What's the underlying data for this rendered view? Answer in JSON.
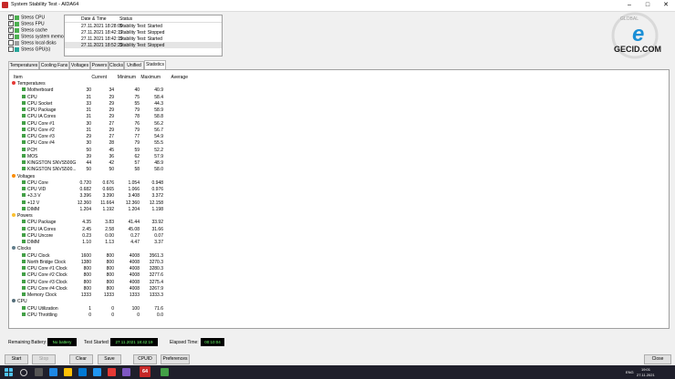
{
  "window": {
    "title": "System Stability Test - AIDA64"
  },
  "stress_options": [
    {
      "label": "Stress CPU",
      "checked": true
    },
    {
      "label": "Stress FPU",
      "checked": true
    },
    {
      "label": "Stress cache",
      "checked": true
    },
    {
      "label": "Stress system memory",
      "checked": true
    },
    {
      "label": "Stress local disks",
      "checked": false
    },
    {
      "label": "Stress GPU(s)",
      "checked": false
    }
  ],
  "log": {
    "headers": [
      "Date & Time",
      "Status"
    ],
    "rows": [
      [
        "27.11.2021 18:28:09",
        "Stability Test: Started"
      ],
      [
        "27.11.2021 18:42:17",
        "Stability Test: Stopped"
      ],
      [
        "27.11.2021 18:42:19",
        "Stability Test: Started"
      ],
      [
        "27.11.2021 18:52:23",
        "Stability Test: Stopped"
      ]
    ]
  },
  "logo": {
    "top": "GLOBAL",
    "main": "GECID.COM",
    "side": "e"
  },
  "tabs": [
    "Temperatures",
    "Cooling Fans",
    "Voltages",
    "Powers",
    "Clocks",
    "Unified",
    "Statistics"
  ],
  "active_tab": 6,
  "table": {
    "headers": [
      "Item",
      "Current",
      "Minimum",
      "Maximum",
      "Average"
    ],
    "rows": [
      {
        "t": "g",
        "label": "Temperatures",
        "icon": "thermometer-icon"
      },
      {
        "t": "r",
        "label": "Motherboard",
        "v": [
          "30",
          "34",
          "40",
          "40.9"
        ]
      },
      {
        "t": "r",
        "label": "CPU",
        "v": [
          "31",
          "29",
          "75",
          "58.4"
        ]
      },
      {
        "t": "r",
        "label": "CPU Socket",
        "v": [
          "33",
          "29",
          "55",
          "44.3"
        ]
      },
      {
        "t": "r",
        "label": "CPU Package",
        "v": [
          "31",
          "29",
          "79",
          "58.9"
        ]
      },
      {
        "t": "r",
        "label": "CPU IA Cores",
        "v": [
          "31",
          "29",
          "78",
          "58.8"
        ]
      },
      {
        "t": "r",
        "label": "CPU Core #1",
        "v": [
          "30",
          "27",
          "76",
          "56.2"
        ]
      },
      {
        "t": "r",
        "label": "CPU Core #2",
        "v": [
          "31",
          "29",
          "79",
          "56.7"
        ]
      },
      {
        "t": "r",
        "label": "CPU Core #3",
        "v": [
          "29",
          "27",
          "77",
          "54.9"
        ]
      },
      {
        "t": "r",
        "label": "CPU Core #4",
        "v": [
          "30",
          "28",
          "79",
          "55.5"
        ]
      },
      {
        "t": "r",
        "label": "PCH",
        "v": [
          "50",
          "45",
          "59",
          "52.2"
        ]
      },
      {
        "t": "r",
        "label": "MOS",
        "v": [
          "39",
          "36",
          "62",
          "57.9"
        ]
      },
      {
        "t": "r",
        "label": "KINGSTON SNVS500G",
        "v": [
          "44",
          "42",
          "57",
          "48.9"
        ]
      },
      {
        "t": "r",
        "label": "KINGSTON SNVS500...",
        "v": [
          "50",
          "50",
          "58",
          "58.0"
        ]
      },
      {
        "t": "g",
        "label": "Voltages",
        "icon": "voltage-icon"
      },
      {
        "t": "r",
        "label": "CPU Core",
        "v": [
          "0.720",
          "0.676",
          "1.054",
          "0.948"
        ]
      },
      {
        "t": "r",
        "label": "CPU VID",
        "v": [
          "0.682",
          "0.665",
          "1.066",
          "0.976"
        ]
      },
      {
        "t": "r",
        "label": "+3.3 V",
        "v": [
          "3.396",
          "3.390",
          "3.408",
          "3.372"
        ]
      },
      {
        "t": "r",
        "label": "+12 V",
        "v": [
          "12.360",
          "11.664",
          "12.360",
          "12.158"
        ]
      },
      {
        "t": "r",
        "label": "DIMM",
        "v": [
          "1.204",
          "1.192",
          "1.204",
          "1.198"
        ]
      },
      {
        "t": "g",
        "label": "Powers",
        "icon": "power-icon"
      },
      {
        "t": "r",
        "label": "CPU Package",
        "v": [
          "4.35",
          "3.83",
          "41.44",
          "33.92"
        ]
      },
      {
        "t": "r",
        "label": "CPU IA Cores",
        "v": [
          "2.45",
          "2.58",
          "45.08",
          "31.66"
        ]
      },
      {
        "t": "r",
        "label": "CPU Uncore",
        "v": [
          "0.23",
          "0.00",
          "0.27",
          "0.07"
        ]
      },
      {
        "t": "r",
        "label": "DIMM",
        "v": [
          "1.10",
          "1.13",
          "4.47",
          "3.37"
        ]
      },
      {
        "t": "g",
        "label": "Clocks",
        "icon": "clock-icon"
      },
      {
        "t": "r",
        "label": "CPU Clock",
        "v": [
          "1600",
          "800",
          "4008",
          "3561.3"
        ]
      },
      {
        "t": "r",
        "label": "North Bridge Clock",
        "v": [
          "1380",
          "800",
          "4008",
          "3270.3"
        ]
      },
      {
        "t": "r",
        "label": "CPU Core #1 Clock",
        "v": [
          "800",
          "800",
          "4008",
          "3280.3"
        ]
      },
      {
        "t": "r",
        "label": "CPU Core #2 Clock",
        "v": [
          "800",
          "800",
          "4008",
          "3277.6"
        ]
      },
      {
        "t": "r",
        "label": "CPU Core #3 Clock",
        "v": [
          "800",
          "800",
          "4008",
          "3275.4"
        ]
      },
      {
        "t": "r",
        "label": "CPU Core #4 Clock",
        "v": [
          "800",
          "800",
          "4008",
          "3267.9"
        ]
      },
      {
        "t": "r",
        "label": "Memory Clock",
        "v": [
          "1333",
          "1333",
          "1333",
          "1333.3"
        ]
      },
      {
        "t": "g",
        "label": "CPU",
        "icon": "cpu-icon"
      },
      {
        "t": "r",
        "label": "CPU Utilization",
        "v": [
          "1",
          "0",
          "100",
          "71.6"
        ]
      },
      {
        "t": "r",
        "label": "CPU Throttling",
        "v": [
          "0",
          "0",
          "0",
          "0.0"
        ]
      }
    ]
  },
  "status": {
    "battery_label": "Remaining Battery:",
    "battery_value": "No battery",
    "started_label": "Test Started:",
    "started_value": "27.11.2021 18:42:19",
    "elapsed_label": "Elapsed Time:",
    "elapsed_value": "00:10:04"
  },
  "buttons": [
    "Start",
    "Stop",
    "Clear",
    "Save",
    "CPUID",
    "Preferences"
  ],
  "close_button": "Close",
  "taskbar": {
    "time": "19:01",
    "date": "27.11.2021",
    "lang": "ENG",
    "app_badge": "64"
  },
  "colors": {
    "accent": "#1a8fd6",
    "status_text": "#6cff6c",
    "taskbar": "#1f1f2b"
  }
}
